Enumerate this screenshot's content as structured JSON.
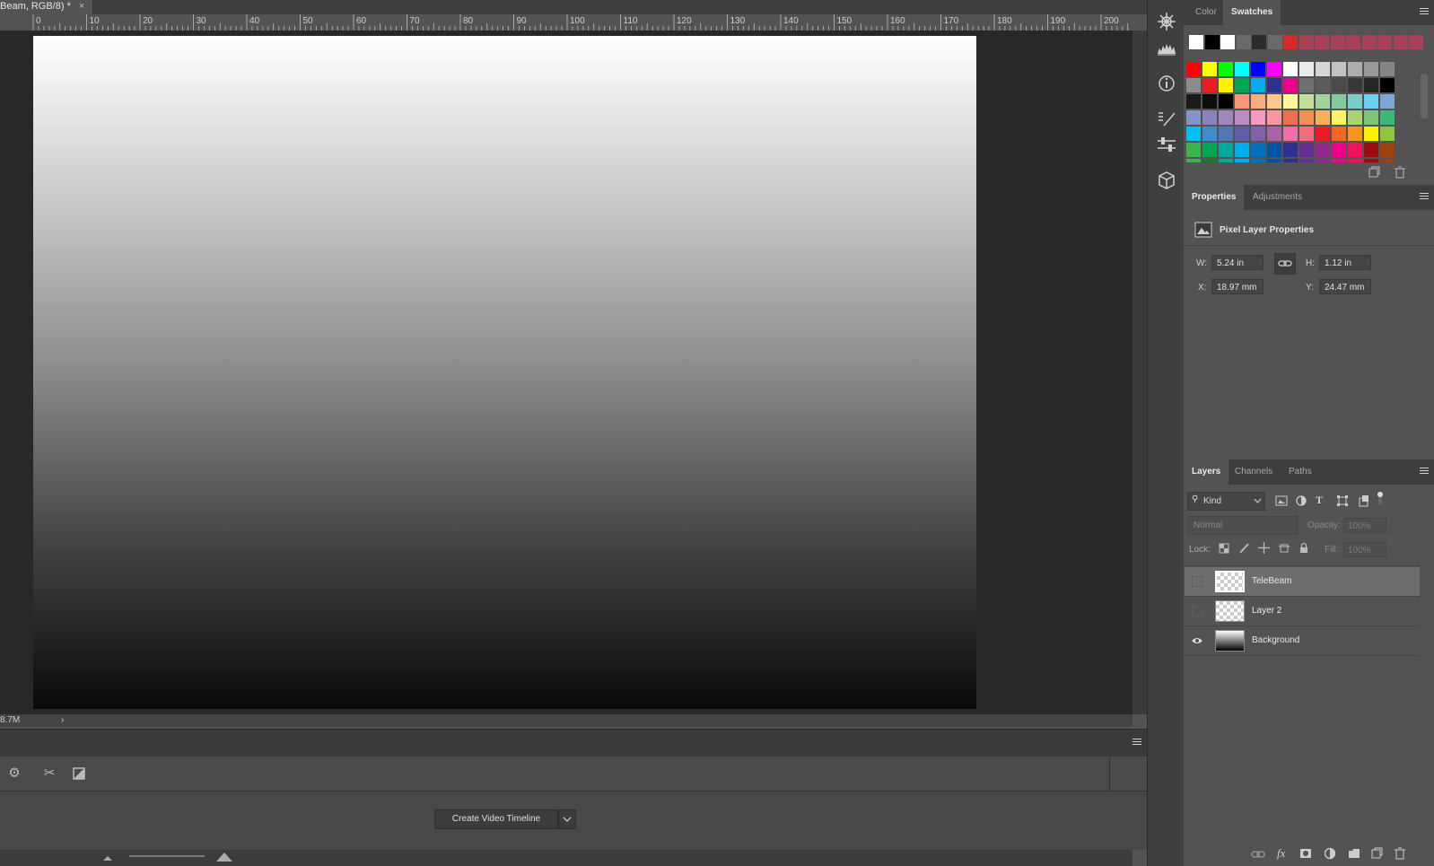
{
  "document": {
    "tab_title": "Beam, RGB/8) *",
    "close_label": "×",
    "status_text": "8.7M",
    "status_arrow": "›"
  },
  "ruler": {
    "labels": [
      "0",
      "10",
      "20",
      "30",
      "40",
      "50",
      "60",
      "70",
      "80",
      "90",
      "100",
      "110",
      "120",
      "130",
      "140",
      "150",
      "160",
      "170",
      "180",
      "190",
      "200"
    ]
  },
  "timeline": {
    "create_button_label": "Create Video Timeline"
  },
  "tools": {
    "icons": [
      "navigator-icon",
      "histogram-icon",
      "info-icon",
      "brush-presets-icon",
      "adjustments-sliders-icon",
      "3d-icon"
    ]
  },
  "swatches_panel": {
    "tabs": [
      "Color",
      "Swatches"
    ],
    "active_tab": "Swatches",
    "recent_colors": [
      "#ffffff",
      "#000000",
      "#ffffff",
      "#6a6a6a",
      "#2b2b2b",
      "#6a6a6a",
      "#d42a2a",
      "#a84058",
      "#a84058",
      "#a84058",
      "#a84058",
      "#a84058",
      "#a84058",
      "#a84058",
      "#a84058"
    ],
    "grid_colors": [
      [
        "#ff0000",
        "#ffff00",
        "#00ff00",
        "#00ffff",
        "#0000ff",
        "#ff00ff",
        "#ffffff",
        "#ebebeb",
        "#d6d6d6",
        "#c2c2c2",
        "#adadad",
        "#999999",
        "#858585"
      ],
      [
        "#8c8c8c",
        "#ed1c24",
        "#fff200",
        "#00a651",
        "#00aeef",
        "#2e3192",
        "#ec008c",
        "#707070",
        "#5c5c5c",
        "#4a4a4a",
        "#383838",
        "#262626",
        "#000000"
      ],
      [
        "#1a1a1a",
        "#0d0d0d",
        "#000000",
        "#f7977a",
        "#f9ad81",
        "#fdc68a",
        "#fff79a",
        "#c4df9b",
        "#a3d39c",
        "#82ca9d",
        "#7bcdc8",
        "#6ecff6",
        "#7ea7d8"
      ],
      [
        "#8493ca",
        "#8882be",
        "#a187be",
        "#bc8dbf",
        "#f49ac2",
        "#f6989d",
        "#f26c4f",
        "#f68e55",
        "#fbaf5c",
        "#fff467",
        "#acd372",
        "#7cc576",
        "#3bb878"
      ],
      [
        "#00bff3",
        "#438ccb",
        "#5574b9",
        "#605ca8",
        "#855fa8",
        "#a763a8",
        "#f06eaa",
        "#f26d7d",
        "#ed1c24",
        "#f26522",
        "#f7941d",
        "#fff200",
        "#8dc73f"
      ],
      [
        "#39b54a",
        "#00a651",
        "#00a99d",
        "#00aeef",
        "#0072bc",
        "#0054a6",
        "#2e3192",
        "#662d91",
        "#92278f",
        "#ec008c",
        "#ed145b",
        "#9e0b0f",
        "#a0410d"
      ]
    ],
    "bottom_row_colors": [
      "#39b54a",
      "#1d7b2e",
      "#00a99d",
      "#00aeef",
      "#0072bc",
      "#0054a6",
      "#2e3192",
      "#662d91",
      "#92278f",
      "#ec008c",
      "#ed145b",
      "#9e0b0f",
      "#a0410d"
    ]
  },
  "properties_panel": {
    "tabs": [
      "Properties",
      "Adjustments"
    ],
    "active_tab": "Properties",
    "heading": "Pixel Layer Properties",
    "w_label": "W:",
    "w_value": "5.24 in",
    "h_label": "H:",
    "h_value": "1.12 in",
    "x_label": "X:",
    "x_value": "18.97 mm",
    "y_label": "Y:",
    "y_value": "24.47 mm"
  },
  "layers_panel": {
    "tabs": [
      "Layers",
      "Channels",
      "Paths"
    ],
    "active_tab": "Layers",
    "filter_label": "Kind",
    "blend_mode": "Normal",
    "opacity_label": "Opacity:",
    "opacity_value": "100%",
    "lock_label": "Lock:",
    "fill_label": "Fill:",
    "fill_value": "100%",
    "layers": [
      {
        "name": "TeleBeam",
        "visible": false,
        "selected": true
      },
      {
        "name": "Layer 2",
        "visible": false,
        "selected": false
      },
      {
        "name": "Background",
        "visible": true,
        "selected": false
      }
    ]
  }
}
